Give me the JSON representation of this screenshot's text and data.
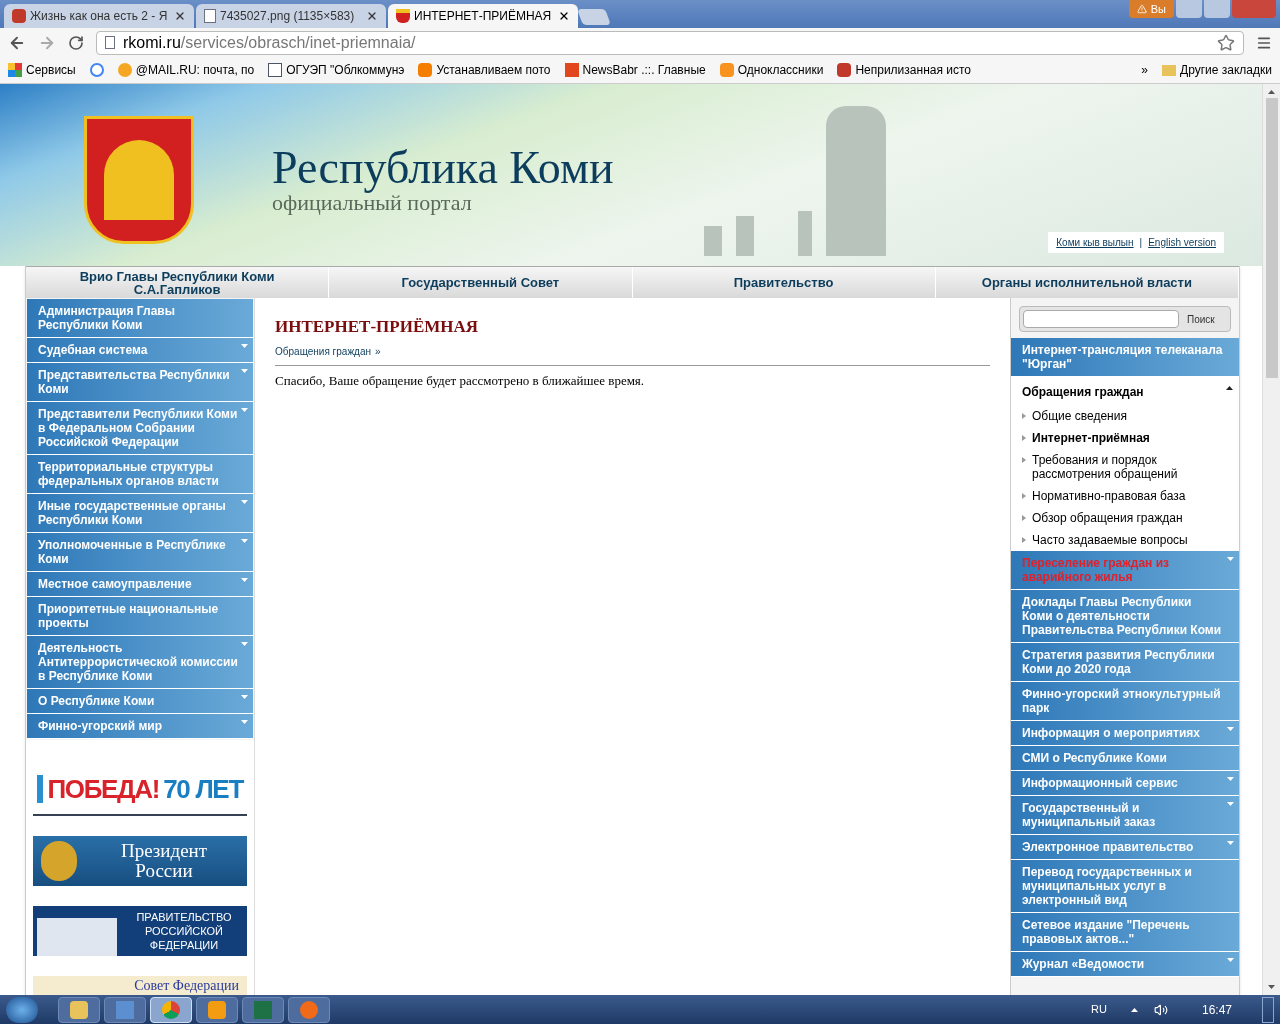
{
  "browser": {
    "tabs": [
      {
        "title": "Жизнь как она есть 2 - Я",
        "selected": false
      },
      {
        "title": "7435027.png (1135×583)",
        "selected": false
      },
      {
        "title": "ИНТЕРНЕТ-ПРИЁМНАЯ",
        "selected": true
      }
    ],
    "user_badge": "Вы",
    "url_host": "rkomi.ru",
    "url_path": "/services/obrasch/inet-priemnaia/",
    "bookmarks": [
      {
        "label": "Сервисы"
      },
      {
        "label": "@MAIL.RU: почта, по"
      },
      {
        "label": "ОГУЭП \"Облкоммунэ"
      },
      {
        "label": "Устанавливаем пото"
      },
      {
        "label": "NewsBabr .::. Главные"
      },
      {
        "label": "Одноклассники"
      },
      {
        "label": "Неприлизанная исто"
      }
    ],
    "bookmarks_more": "»",
    "other_bookmarks": "Другие закладки"
  },
  "site": {
    "title": "Республика Коми",
    "subtitle": "официальный портал",
    "lang_links": [
      "Коми кыв вылын",
      "English version"
    ],
    "lang_separator": "|"
  },
  "top_nav": [
    {
      "lines": [
        "Врио Главы Республики Коми",
        "С.А.Гапликов"
      ]
    },
    {
      "lines": [
        "Государственный Совет"
      ]
    },
    {
      "lines": [
        "Правительство"
      ]
    },
    {
      "lines": [
        "Органы исполнительной власти"
      ]
    }
  ],
  "left_menu": [
    {
      "label": "Администрация Главы Республики Коми",
      "has_submenu": false
    },
    {
      "label": "Судебная система",
      "has_submenu": true
    },
    {
      "label": "Представительства Республики Коми",
      "has_submenu": true
    },
    {
      "label": "Представители Республики Коми в Федеральном Собрании Российской Федерации",
      "has_submenu": true
    },
    {
      "label": "Территориальные структуры федеральных органов власти",
      "has_submenu": false
    },
    {
      "label": "Иные государственные органы Республики Коми",
      "has_submenu": true
    },
    {
      "label": "Уполномоченные в Республике Коми",
      "has_submenu": true
    },
    {
      "label": "Местное самоуправление",
      "has_submenu": true
    },
    {
      "label": "Приоритетные национальные проекты",
      "has_submenu": false
    },
    {
      "label": "Деятельность Антитеррористической комиссии в Республике Коми",
      "has_submenu": true
    },
    {
      "label": "О Республике Коми",
      "has_submenu": true
    },
    {
      "label": "Финно-угорский мир",
      "has_submenu": true
    }
  ],
  "banners": [
    {
      "kind": "victory",
      "lines": [
        "ПОБЕДА!",
        "70 ЛЕТ"
      ]
    },
    {
      "kind": "president",
      "lines": [
        "Президент",
        "России"
      ]
    },
    {
      "kind": "government",
      "lines": [
        "ПРАВИТЕЛЬСТВО",
        "РОССИЙСКОЙ",
        "ФЕДЕРАЦИИ"
      ]
    },
    {
      "kind": "council",
      "lines": [
        "Совет Федерации"
      ]
    }
  ],
  "main": {
    "heading": "ИНТЕРНЕТ-ПРИЁМНАЯ",
    "breadcrumb": "Обращения граждан",
    "breadcrumb_sep": "»",
    "message": "Спасибо, Ваше обращение будет рассмотрено в ближайшее время."
  },
  "search": {
    "button": "Поиск"
  },
  "right_menu": [
    {
      "kind": "link",
      "label": "Интернет-трансляция телеканала \"Юрган\"",
      "has_submenu": false,
      "alert": false
    },
    {
      "kind": "section",
      "label": "Обращения граждан",
      "expanded": true,
      "children": [
        {
          "label": "Общие сведения",
          "selected": false
        },
        {
          "label": "Интернет-приёмная",
          "selected": true
        },
        {
          "label": "Требования и порядок рассмотрения обращений",
          "selected": false
        },
        {
          "label": "Нормативно-правовая база",
          "selected": false
        },
        {
          "label": "Обзор обращения граждан",
          "selected": false
        },
        {
          "label": "Часто задаваемые вопросы",
          "selected": false
        }
      ]
    },
    {
      "kind": "link",
      "label": "Переселение граждан из аварийного жилья",
      "has_submenu": true,
      "alert": true
    },
    {
      "kind": "link",
      "label": "Доклады Главы Республики Коми о деятельности Правительства Республики Коми",
      "has_submenu": false,
      "alert": false
    },
    {
      "kind": "link",
      "label": "Стратегия развития Республики Коми до 2020 года",
      "has_submenu": false,
      "alert": false
    },
    {
      "kind": "link",
      "label": "Финно-угорский этнокультурный парк",
      "has_submenu": false,
      "alert": false
    },
    {
      "kind": "link",
      "label": "Информация о мероприятиях",
      "has_submenu": true,
      "alert": false
    },
    {
      "kind": "link",
      "label": "СМИ о Республике Коми",
      "has_submenu": false,
      "alert": false
    },
    {
      "kind": "link",
      "label": "Информационный сервис",
      "has_submenu": true,
      "alert": false
    },
    {
      "kind": "link",
      "label": "Государственный и муниципальный заказ",
      "has_submenu": true,
      "alert": false
    },
    {
      "kind": "link",
      "label": "Электронное правительство",
      "has_submenu": true,
      "alert": false
    },
    {
      "kind": "link",
      "label": "Перевод государственных и муниципальных услуг в электронный вид",
      "has_submenu": false,
      "alert": false
    },
    {
      "kind": "link",
      "label": "Сетевое издание \"Перечень правовых актов...\"",
      "has_submenu": false,
      "alert": false
    },
    {
      "kind": "link",
      "label": "Журнал «Ведомости",
      "has_submenu": true,
      "alert": false
    }
  ],
  "taskbar": {
    "apps": [
      {
        "kind": "folder",
        "active": false
      },
      {
        "kind": "network",
        "active": false
      },
      {
        "kind": "chrome",
        "active": true
      },
      {
        "kind": "player",
        "active": false
      },
      {
        "kind": "excel",
        "active": false
      },
      {
        "kind": "flame",
        "active": false
      }
    ],
    "language": "RU",
    "time": "16:47"
  }
}
